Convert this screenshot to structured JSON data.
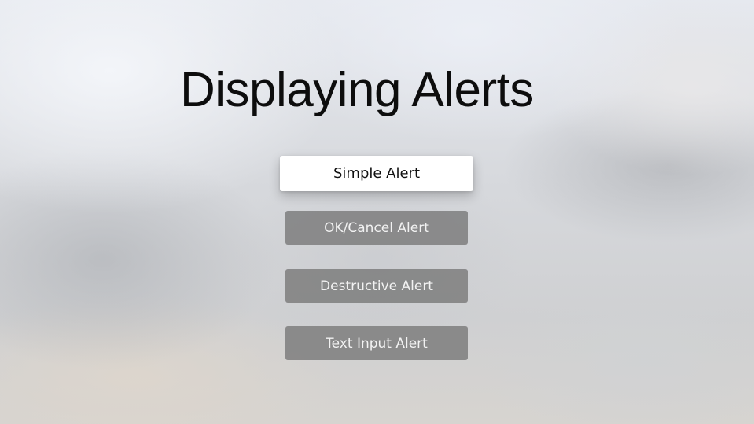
{
  "page": {
    "title": "Displaying Alerts"
  },
  "buttons": {
    "simple_alert": "Simple Alert",
    "ok_cancel_alert": "OK/Cancel Alert",
    "destructive_alert": "Destructive Alert",
    "text_input_alert": "Text Input Alert"
  },
  "state": {
    "focused_button": "Simple Alert"
  },
  "colors": {
    "focused_button_bg": "#ffffff",
    "button_bg": "#7f7f7f",
    "title_text": "#0d0d0d",
    "button_text": "#f2f2f2"
  }
}
